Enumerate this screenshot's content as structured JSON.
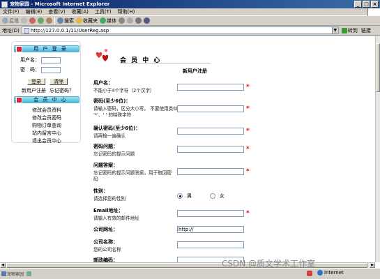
{
  "window": {
    "title": "宠物家园 - Microsoft Internet Explorer",
    "controls": [
      "_",
      "□",
      "×"
    ]
  },
  "menubar": [
    "文件(F)",
    "编辑(E)",
    "查看(V)",
    "收藏(A)",
    "工具(T)",
    "帮助(H)"
  ],
  "toolbar": {
    "back": "后退",
    "search": "搜索",
    "favorites": "收藏夹",
    "media": "媒体"
  },
  "address": {
    "label": "地址(D)",
    "url": "http://127.0.0.1/11/UserReg.asp",
    "go": "转到",
    "links": "链接"
  },
  "sidebar": {
    "login_header": "用 户 登 录",
    "username_label": "用户名：",
    "password_label": "密　码：",
    "login_button": "登录",
    "clear_button": "清除",
    "register_link": "新用户注册",
    "forgot_link": "忘记密码？",
    "member_header": "会 员 中 心",
    "menu": [
      "修改会员资料",
      "修改会员密码",
      "购物订单查询",
      "站内留言中心",
      "退出会员中心"
    ]
  },
  "main": {
    "section_title": "会 员 中 心",
    "form_title": "新用户注册",
    "fields": [
      {
        "label": "用户名：",
        "hint": "不能小于4个字符（2个汉字）",
        "value": "",
        "required": true
      },
      {
        "label": "密码(至少6位)：",
        "hint": "请输入密码，区分大小写。 不要使用类似 '*'、' ' 的特殊字符",
        "value": "",
        "required": true
      },
      {
        "label": "确认密码(至少6位)：",
        "hint": "请再输一遍确认",
        "value": "",
        "required": true
      },
      {
        "label": "密码问题：",
        "hint": "忘记密码的提示问题",
        "value": "",
        "required": true
      },
      {
        "label": "问题答案：",
        "hint": "忘记密码的提示问题答案，用于取回密码",
        "value": "",
        "required": true
      },
      {
        "label": "性别：",
        "hint": "请选择您的性别",
        "options": [
          "男",
          "女"
        ],
        "selected": "男"
      },
      {
        "label": "Email地址：",
        "hint": "请输入有效的邮件地址",
        "value": "",
        "required": true
      },
      {
        "label": "公司网址：",
        "hint": "",
        "value": "http://",
        "required": false
      },
      {
        "label": "公司名称：",
        "hint": "您的公司名称",
        "value": "",
        "required": false
      },
      {
        "label": "邮政编码：",
        "hint": "",
        "value": "",
        "required": false
      }
    ]
  },
  "statusbar": {
    "items": [
      "宠物家园",
      ""
    ],
    "zone": "Internet"
  },
  "watermark": "CSDN @质文学术工作室"
}
